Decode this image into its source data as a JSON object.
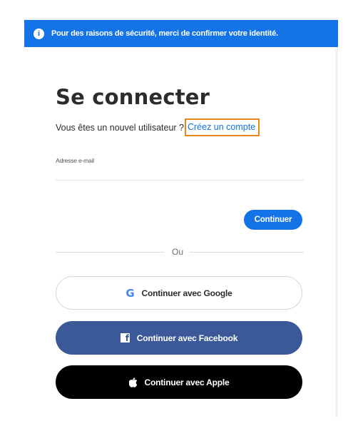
{
  "banner": {
    "message": "Pour des raisons de sécurité, merci de confirmer votre identité."
  },
  "signin": {
    "title": "Se connecter",
    "new_user_prompt": "Vous êtes un nouvel utilisateur ?",
    "create_account_link": "Créez un compte",
    "email_label": "Adresse e-mail",
    "email_value": "",
    "continue_label": "Continuer",
    "divider_text": "Ou"
  },
  "social": {
    "google_label": "Continuer avec Google",
    "facebook_label": "Continuer avec Facebook",
    "apple_label": "Continuer avec Apple"
  },
  "icons": {
    "info": "info-icon",
    "google": "google-icon",
    "facebook": "facebook-icon",
    "apple": "apple-icon"
  },
  "colors": {
    "accent": "#1473e6",
    "link_focus_outline": "#e68619",
    "facebook": "#3b5998",
    "apple": "#000000"
  }
}
